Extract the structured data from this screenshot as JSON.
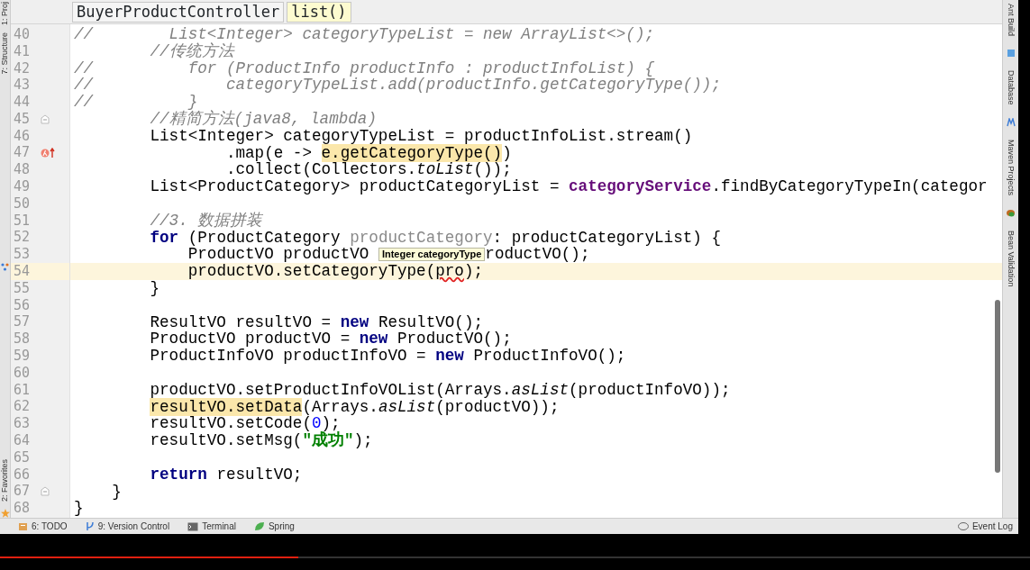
{
  "breadcrumbs": [
    {
      "label": "BuyerProductController",
      "selected": false
    },
    {
      "label": "list()",
      "selected": true
    }
  ],
  "left_tool_tabs": [
    {
      "label": "1: Proj",
      "kind": "project"
    },
    {
      "label": "7: Structure",
      "kind": "structure"
    },
    {
      "label": "2: Favorites",
      "kind": "favorites"
    }
  ],
  "right_tool_tabs": [
    {
      "label": "Ant Build",
      "kind": "ant"
    },
    {
      "label": "Database",
      "kind": "database"
    },
    {
      "label": "Maven Projects",
      "kind": "maven"
    },
    {
      "label": "Bean Validation",
      "kind": "bean"
    }
  ],
  "lines": [
    {
      "number": "40",
      "current": false,
      "fold": false,
      "override": false,
      "segments": [
        {
          "kind": "comment",
          "text": "//        List<Integer> categoryTypeList = new ArrayList<>();"
        }
      ]
    },
    {
      "number": "41",
      "current": false,
      "fold": false,
      "override": false,
      "segments": [
        {
          "kind": "comment",
          "text": "        //传统方法"
        }
      ]
    },
    {
      "number": "42",
      "current": false,
      "fold": false,
      "override": false,
      "segments": [
        {
          "kind": "comment",
          "text": "//          for (ProductInfo productInfo : productInfoList) {"
        }
      ]
    },
    {
      "number": "43",
      "current": false,
      "fold": false,
      "override": false,
      "segments": [
        {
          "kind": "comment",
          "text": "//              categoryTypeList.add(productInfo.getCategoryType());"
        }
      ]
    },
    {
      "number": "44",
      "current": false,
      "fold": false,
      "override": false,
      "segments": [
        {
          "kind": "comment",
          "text": "//          }"
        }
      ]
    },
    {
      "number": "45",
      "current": false,
      "fold": true,
      "override": false,
      "segments": [
        {
          "kind": "comment",
          "text": "        //精简方法(java8, lambda)"
        }
      ]
    },
    {
      "number": "46",
      "current": false,
      "fold": false,
      "override": false,
      "segments": [
        {
          "kind": "plain",
          "text": "        List<Integer> categoryTypeList = productInfoList.stream()"
        }
      ]
    },
    {
      "number": "47",
      "current": false,
      "fold": false,
      "override": true,
      "segments": [
        {
          "kind": "plain",
          "text": "                .map(e -> "
        },
        {
          "kind": "highlight",
          "text": "e.getCategoryType()"
        },
        {
          "kind": "plain",
          "text": ")"
        }
      ]
    },
    {
      "number": "48",
      "current": false,
      "fold": false,
      "override": false,
      "segments": [
        {
          "kind": "plain",
          "text": "                .collect(Collectors."
        },
        {
          "kind": "static",
          "text": "toList"
        },
        {
          "kind": "plain",
          "text": "());"
        }
      ]
    },
    {
      "number": "49",
      "current": false,
      "fold": false,
      "override": false,
      "segments": [
        {
          "kind": "plain",
          "text": "        List<ProductCategory> productCategoryList = "
        },
        {
          "kind": "field",
          "text": "categoryService"
        },
        {
          "kind": "plain",
          "text": ".findByCategoryTypeIn(categor"
        }
      ]
    },
    {
      "number": "50",
      "current": false,
      "fold": false,
      "override": false
    },
    {
      "number": "51",
      "current": false,
      "fold": false,
      "override": false,
      "segments": [
        {
          "kind": "comment",
          "text": "        //3. 数据拼装"
        }
      ]
    },
    {
      "number": "52",
      "current": false,
      "fold": false,
      "override": false,
      "segments": [
        {
          "kind": "keyword",
          "text": "        for"
        },
        {
          "kind": "plain",
          "text": " (ProductCategory "
        },
        {
          "kind": "unused",
          "text": "productCategory"
        },
        {
          "kind": "plain",
          "text": ": productCategoryList) {"
        }
      ]
    },
    {
      "number": "53",
      "current": false,
      "fold": false,
      "override": false,
      "tooltip": "Integer categoryType",
      "segments": [
        {
          "kind": "plain",
          "text": "            ProductVO productVO "
        },
        {
          "kind": "plain",
          "text": "roductVO();"
        }
      ]
    },
    {
      "number": "54",
      "current": true,
      "fold": false,
      "override": false,
      "segments": [
        {
          "kind": "plain",
          "text": "            productVO.setCategoryType("
        },
        {
          "kind": "error",
          "text": "pro"
        },
        {
          "kind": "plain",
          "text": ");"
        }
      ]
    },
    {
      "number": "55",
      "current": false,
      "fold": false,
      "override": false,
      "segments": [
        {
          "kind": "plain",
          "text": "        }"
        }
      ]
    },
    {
      "number": "56",
      "current": false,
      "fold": false,
      "override": false
    },
    {
      "number": "57",
      "current": false,
      "fold": false,
      "override": false,
      "segments": [
        {
          "kind": "plain",
          "text": "        ResultVO resultVO = "
        },
        {
          "kind": "keyword",
          "text": "new"
        },
        {
          "kind": "plain",
          "text": " ResultVO();"
        }
      ]
    },
    {
      "number": "58",
      "current": false,
      "fold": false,
      "override": false,
      "segments": [
        {
          "kind": "plain",
          "text": "        ProductVO productVO = "
        },
        {
          "kind": "keyword",
          "text": "new"
        },
        {
          "kind": "plain",
          "text": " ProductVO();"
        }
      ]
    },
    {
      "number": "59",
      "current": false,
      "fold": false,
      "override": false,
      "segments": [
        {
          "kind": "plain",
          "text": "        ProductInfoVO productInfoVO = "
        },
        {
          "kind": "keyword",
          "text": "new"
        },
        {
          "kind": "plain",
          "text": " ProductInfoVO();"
        }
      ]
    },
    {
      "number": "60",
      "current": false,
      "fold": false,
      "override": false
    },
    {
      "number": "61",
      "current": false,
      "fold": false,
      "override": false,
      "segments": [
        {
          "kind": "plain",
          "text": "        productVO.setProductInfoVOList(Arrays."
        },
        {
          "kind": "static",
          "text": "asList"
        },
        {
          "kind": "plain",
          "text": "(productInfoVO));"
        }
      ]
    },
    {
      "number": "62",
      "current": false,
      "fold": false,
      "override": false,
      "segments": [
        {
          "kind": "highlight",
          "text": "        resultVO.setData"
        },
        {
          "kind": "plain",
          "text": "(Arrays."
        },
        {
          "kind": "static",
          "text": "asList"
        },
        {
          "kind": "plain",
          "text": "(productVO));"
        }
      ]
    },
    {
      "number": "63",
      "current": false,
      "fold": false,
      "override": false,
      "segments": [
        {
          "kind": "plain",
          "text": "        resultVO.setCode("
        },
        {
          "kind": "number",
          "text": "0"
        },
        {
          "kind": "plain",
          "text": ");"
        }
      ]
    },
    {
      "number": "64",
      "current": false,
      "fold": false,
      "override": false,
      "segments": [
        {
          "kind": "plain",
          "text": "        resultVO.setMsg("
        },
        {
          "kind": "string",
          "text": "\"成功\""
        },
        {
          "kind": "plain",
          "text": ");"
        }
      ]
    },
    {
      "number": "65",
      "current": false,
      "fold": false,
      "override": false
    },
    {
      "number": "66",
      "current": false,
      "fold": false,
      "override": false,
      "segments": [
        {
          "kind": "keyword",
          "text": "        return"
        },
        {
          "kind": "plain",
          "text": " resultVO;"
        }
      ]
    },
    {
      "number": "67",
      "current": false,
      "fold": true,
      "override": false,
      "segments": [
        {
          "kind": "plain",
          "text": "    }"
        }
      ]
    },
    {
      "number": "68",
      "current": false,
      "fold": false,
      "override": false,
      "segments": [
        {
          "kind": "plain",
          "text": "}"
        }
      ]
    }
  ],
  "bottom_tool_tabs": [
    {
      "label": "6: TODO",
      "kind": "todo"
    },
    {
      "label": "9: Version Control",
      "kind": "vcs"
    },
    {
      "label": "Terminal",
      "kind": "terminal"
    },
    {
      "label": "Spring",
      "kind": "spring"
    }
  ],
  "event_log": "Event Log",
  "video_progress": {
    "level": 0.29
  }
}
